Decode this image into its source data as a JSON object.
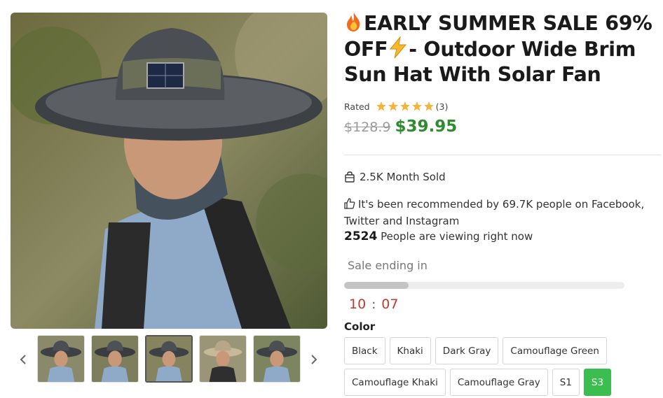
{
  "product": {
    "title_prefix_icon": "fire-emoji",
    "title_line1": "EARLY SUMMER SALE 69% OFF",
    "title_mid_icon": "lightning-emoji",
    "title_line2": "- Outdoor Wide Brim Sun Hat With Solar Fan"
  },
  "rating": {
    "label": "Rated",
    "stars": 5,
    "count_text": "(3)",
    "star_color": "#f5b33b"
  },
  "price": {
    "original": "$128.9",
    "sale": "$39.95",
    "sale_color": "#2e8b2e"
  },
  "stats": {
    "sold_text": "2.5K Month Sold",
    "recommend_text": "It's been recommended by 69.7K people on Facebook, Twitter and Instagram",
    "viewers_count": "2524",
    "viewers_text": "People are viewing right now"
  },
  "sale": {
    "label": "Sale ending in",
    "progress_fraction": 0.23,
    "minutes": "10",
    "separator": ":",
    "seconds": "07"
  },
  "color": {
    "label": "Color",
    "options": [
      "Black",
      "Khaki",
      "Dark Gray",
      "Camouflage Green",
      "Camouflage Khaki",
      "Camouflage Gray",
      "S1",
      "S3"
    ],
    "selected": "S3",
    "selected_color": "#3bbd4f"
  },
  "gallery": {
    "thumb_count": 5,
    "active_index": 2,
    "prev_icon": "chevron-left-icon",
    "next_icon": "chevron-right-icon"
  }
}
